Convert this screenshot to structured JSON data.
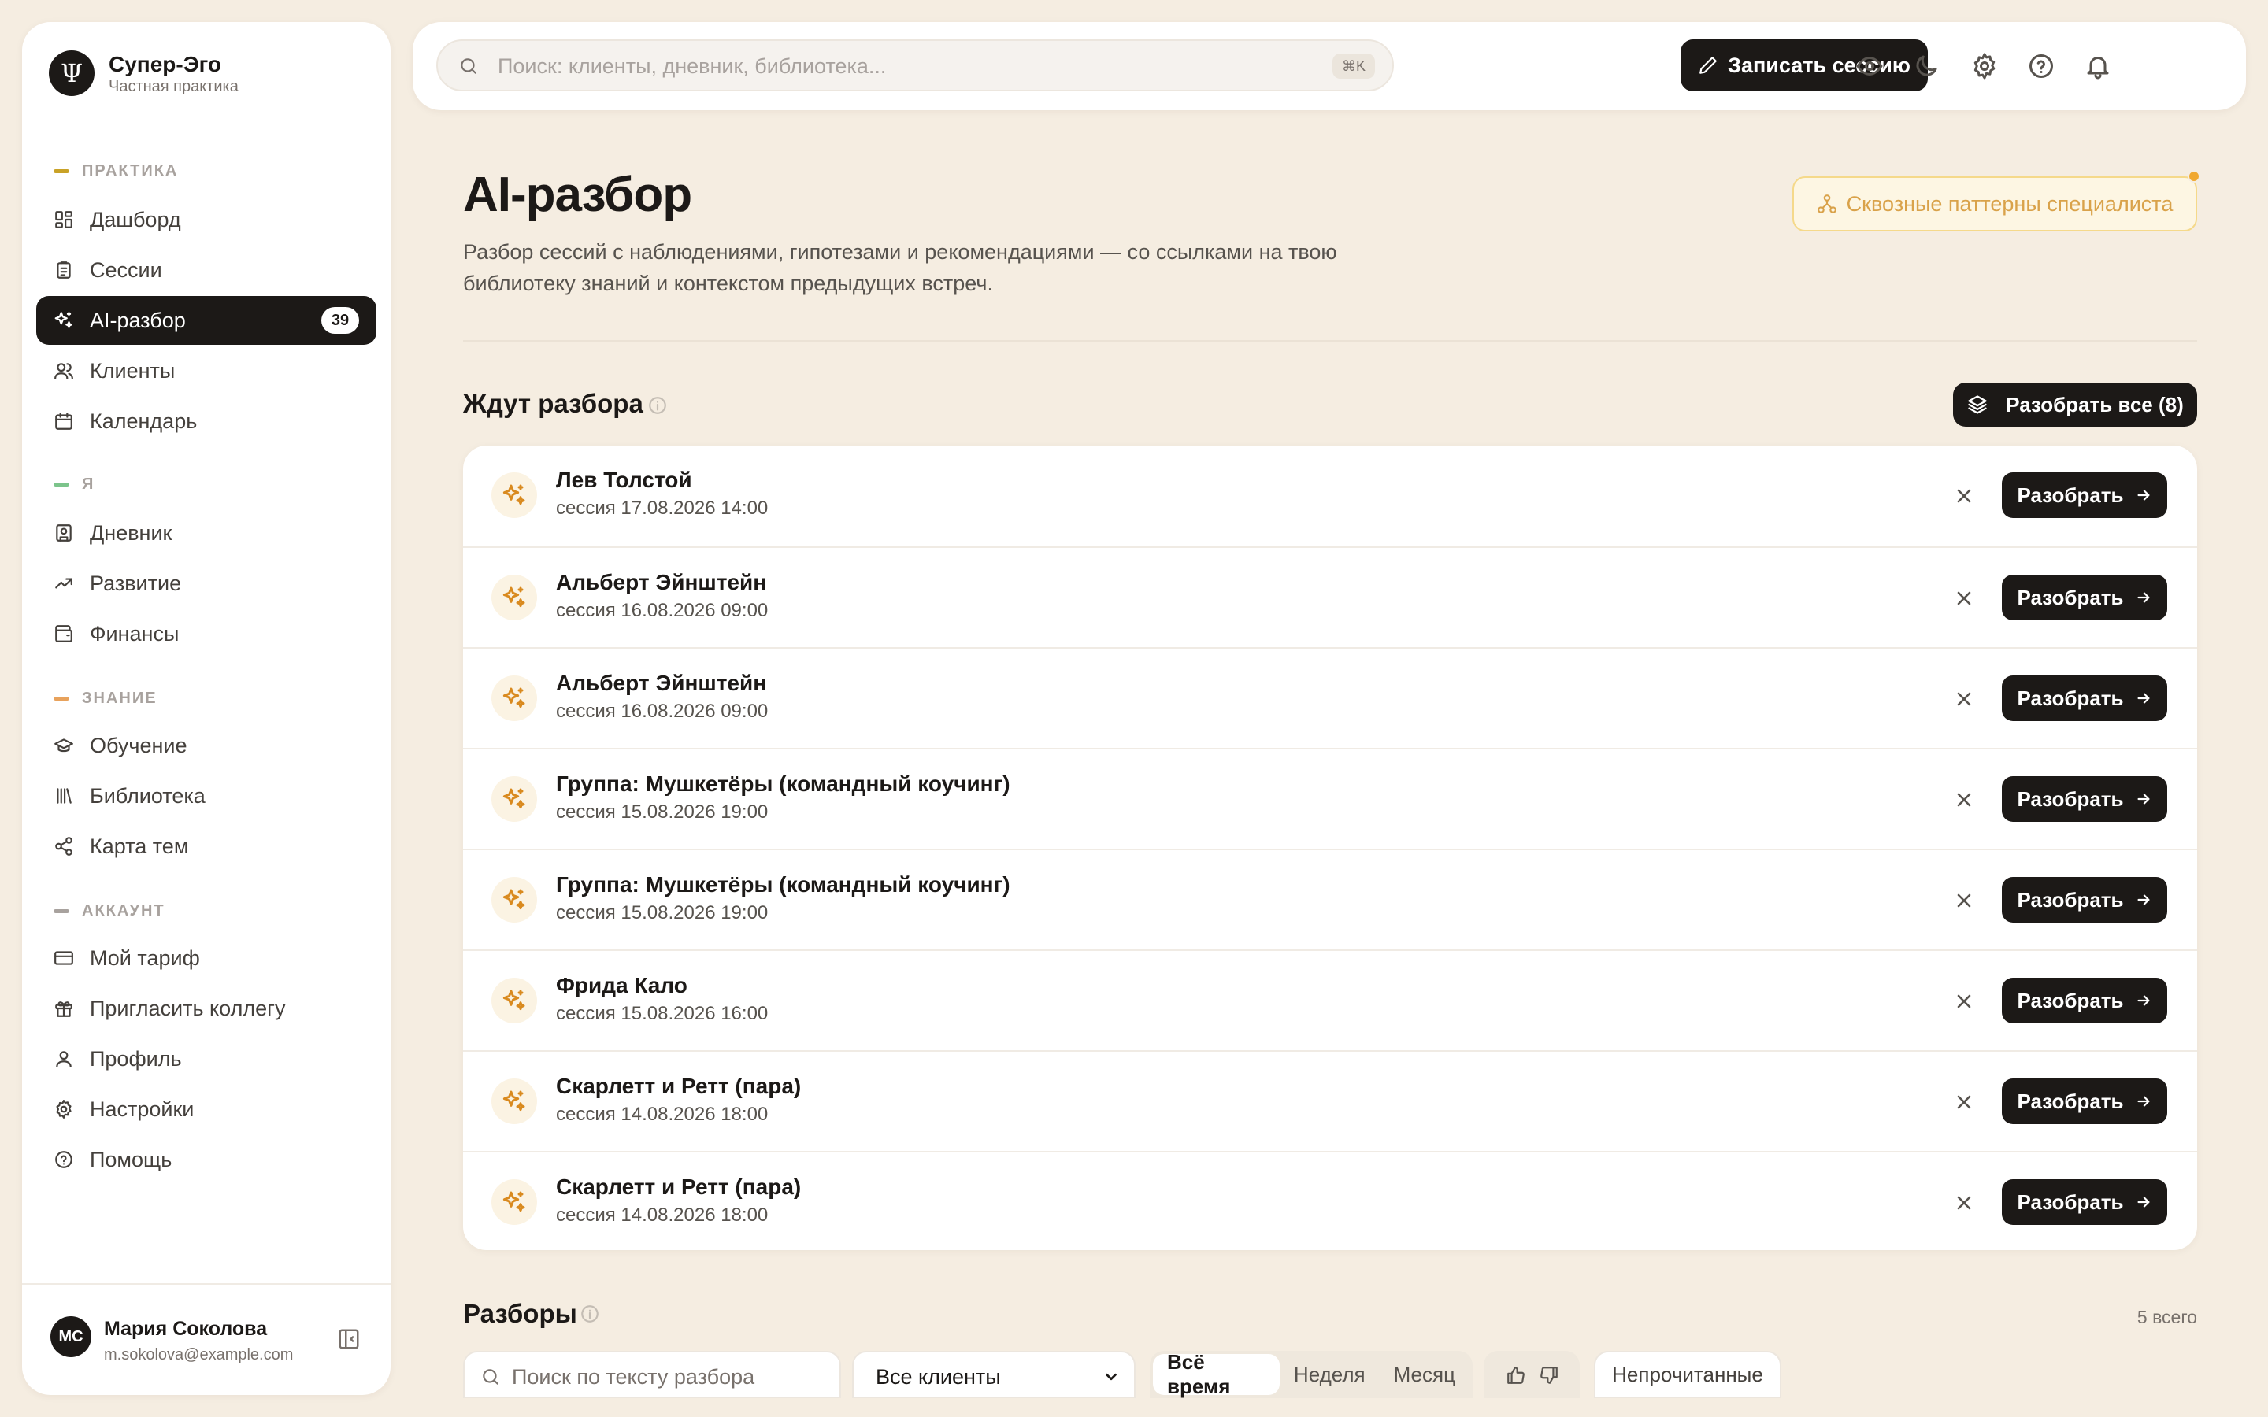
{
  "brand": {
    "title": "Супер-Эго",
    "subtitle": "Частная практика",
    "logo_glyph": "Ψ"
  },
  "sidebar": {
    "sections": [
      {
        "label": "ПРАКТИКА",
        "color": "#c9a227"
      },
      {
        "label": "Я",
        "color": "#7cc48b"
      },
      {
        "label": "ЗНАНИЕ",
        "color": "#e8a25c"
      },
      {
        "label": "АККАУНТ",
        "color": "#a8a29e"
      }
    ],
    "items": [
      {
        "label": "Дашборд",
        "icon": "grid-icon"
      },
      {
        "label": "Сессии",
        "icon": "clipboard-icon"
      },
      {
        "label": "AI-разбор",
        "icon": "sparkles-icon",
        "badge": "39",
        "active": true
      },
      {
        "label": "Клиенты",
        "icon": "users-icon"
      },
      {
        "label": "Календарь",
        "icon": "calendar-icon"
      },
      {
        "label": "Дневник",
        "icon": "notebook-icon"
      },
      {
        "label": "Развитие",
        "icon": "trending-up-icon"
      },
      {
        "label": "Финансы",
        "icon": "wallet-icon"
      },
      {
        "label": "Обучение",
        "icon": "graduation-cap-icon"
      },
      {
        "label": "Библиотека",
        "icon": "library-icon"
      },
      {
        "label": "Карта тем",
        "icon": "share-nodes-icon"
      },
      {
        "label": "Мой тариф",
        "icon": "credit-card-icon"
      },
      {
        "label": "Пригласить коллегу",
        "icon": "gift-icon"
      },
      {
        "label": "Профиль",
        "icon": "user-icon"
      },
      {
        "label": "Настройки",
        "icon": "gear-icon"
      },
      {
        "label": "Помощь",
        "icon": "help-circle-icon"
      }
    ]
  },
  "user": {
    "initials": "МС",
    "name": "Мария Соколова",
    "email": "m.sokolova@example.com"
  },
  "topbar": {
    "search_placeholder": "Поиск: клиенты, дневник, библиотека...",
    "shortcut": "⌘K",
    "record_label": "Записать сессию",
    "icons": [
      "eye-icon",
      "moon-icon",
      "gear-icon",
      "help-circle-icon",
      "bell-icon"
    ]
  },
  "page": {
    "title": "AI-разбор",
    "description": "Разбор сессий с наблюдениями, гипотезами и рекомендациями — со ссылками на твою библиотеку знаний и контекстом предыдущих встреч.",
    "patterns_label": "Сквозные паттерны специалиста"
  },
  "queue": {
    "title": "Ждут разбора",
    "review_all_label": "Разобрать все (8)",
    "action_label": "Разобрать",
    "items": [
      {
        "name": "Лев Толстой",
        "date": "сессия 17.08.2026 14:00"
      },
      {
        "name": "Альберт Эйнштейн",
        "date": "сессия 16.08.2026 09:00"
      },
      {
        "name": "Альберт Эйнштейн",
        "date": "сессия 16.08.2026 09:00"
      },
      {
        "name": "Группа: Мушкетёры (командный коучинг)",
        "date": "сессия 15.08.2026 19:00"
      },
      {
        "name": "Группа: Мушкетёры (командный коучинг)",
        "date": "сессия 15.08.2026 19:00"
      },
      {
        "name": "Фрида Кало",
        "date": "сессия 15.08.2026 16:00"
      },
      {
        "name": "Скарлетт и Ретт (пара)",
        "date": "сессия 14.08.2026 18:00"
      },
      {
        "name": "Скарлетт и Ретт (пара)",
        "date": "сессия 14.08.2026 18:00"
      }
    ]
  },
  "reviews": {
    "title": "Разборы",
    "total": "5 всего",
    "search_placeholder": "Поиск по тексту разбора",
    "client_filter": "Все клиенты",
    "periods": [
      "Всё время",
      "Неделя",
      "Месяц"
    ],
    "active_period": "Всё время",
    "unread_label": "Непрочитанные"
  },
  "colors": {
    "accent": "#1c1917",
    "background": "#f5ede1",
    "spark": "#d98a1f"
  }
}
